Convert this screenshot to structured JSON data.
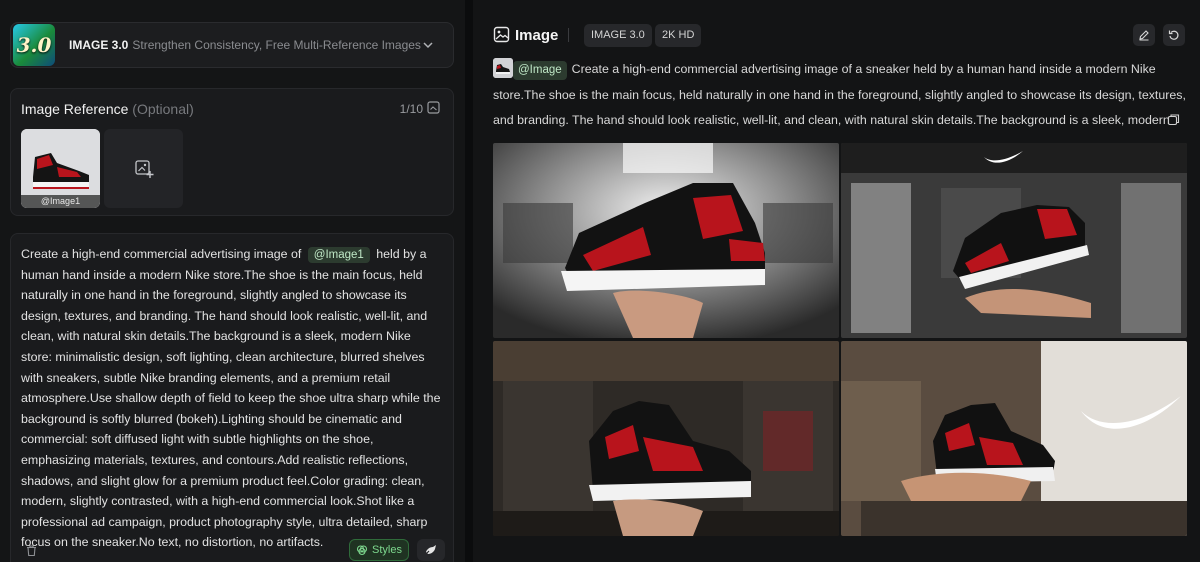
{
  "model": {
    "logo_text": "3.0",
    "name": "IMAGE 3.0",
    "description": "Strengthen Consistency, Free Multi-Reference Images, Co..."
  },
  "reference": {
    "title": "Image Reference",
    "optional": "(Optional)",
    "count": "1/10",
    "items": [
      {
        "label": "@Image1"
      }
    ]
  },
  "prompt": {
    "before": "Create a high-end commercial advertising image of",
    "mention": "@Image1",
    "after": "held by a human hand inside a modern Nike store.The shoe is the main focus, held naturally in one hand in the foreground, slightly angled to showcase its design, textures, and branding. The hand should look realistic, well-lit, and clean, with natural skin details.The background is a sleek, modern Nike store: minimalistic design, soft lighting, clean architecture, blurred shelves with sneakers, subtle Nike branding elements, and a premium retail atmosphere.Use shallow depth of field to keep the shoe ultra sharp while the background is softly blurred (bokeh).Lighting should be cinematic and commercial: soft diffused light with subtle highlights on the shoe, emphasizing materials, textures, and contours.Add realistic reflections, shadows, and slight glow for a premium product feel.Color grading: clean, modern, slightly contrasted, with a high-end commercial look.Shot like a professional ad campaign, product photography style, ultra detailed, sharp focus on the sneaker.No text, no distortion, no artifacts."
  },
  "actions": {
    "styles_label": "Styles"
  },
  "result": {
    "title": "Image",
    "tags": [
      "IMAGE 3.0",
      "2K HD"
    ],
    "mention": "@Image",
    "prompt": "Create a high-end commercial advertising image of a sneaker held by a human hand inside a modern Nike store.The shoe is the main focus, held naturally in one hand in the foreground, slightly angled to showcase its design, textures, and branding. The hand should look realistic, well-lit, and clean, with natural skin details.The background is a sleek, modern Nike store: minimal"
  },
  "colors": {
    "accent_green": "#7dd88e",
    "shoe_red": "#b8141c",
    "background": "#131415"
  },
  "icons": [
    "chevron-down-icon",
    "gallery-icon",
    "add-image-icon",
    "trash-icon",
    "styles-icon",
    "brush-icon",
    "image-icon",
    "edit-icon",
    "regenerate-icon",
    "copy-icon"
  ]
}
